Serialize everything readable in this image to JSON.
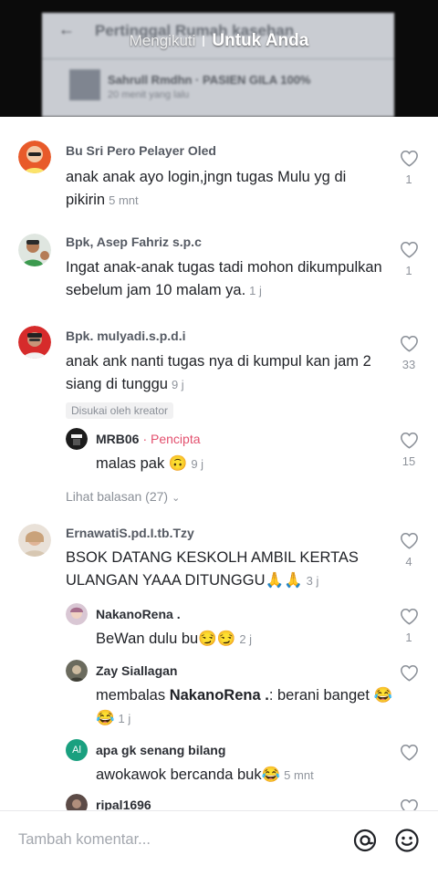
{
  "video": {
    "header_text": "Pertinggal Rumah kasehan",
    "author_name": "Sahrull Rmdhn · PASIEN GILA 100%",
    "author_sub": "20 menit yang lalu"
  },
  "feed_tabs": {
    "following": "Mengikuti",
    "for_you": "Untuk Anda"
  },
  "comments": [
    {
      "username": "Bu Sri Pero Pelayer Oled",
      "text": "anak anak ayo login,jngn tugas Mulu yg di pikirin",
      "time": "5 mnt",
      "likes": "1"
    },
    {
      "username": "Bpk, Asep Fahriz s.p.c",
      "text": "Ingat anak-anak tugas tadi mohon dikumpulkan sebelum jam 10 malam ya.",
      "time": "1 j",
      "likes": "1"
    },
    {
      "username": "Bpk. mulyadi.s.p.d.i",
      "text": "anak ank nanti tugas nya di kumpul kan jam 2 siang di tunggu",
      "time": "9 j",
      "likes": "33",
      "liked_by_creator": "Disukai oleh kreator",
      "reply": {
        "username": "MRB06",
        "creator_label": "· Pencipta",
        "text": "malas pak 🙃",
        "time": "9 j",
        "likes": "15"
      },
      "view_replies": "Lihat balasan (27)"
    },
    {
      "username": "ErnawatiS.pd.I.tb.Tzy",
      "text": "BSOK DATANG KESKOLH AMBIL KERTAS ULANGAN YAAA DITUNGGU🙏🙏",
      "time": "3 j",
      "likes": "4",
      "replies": [
        {
          "username": "NakanoRena .",
          "text": "BeWan dulu bu😏😏",
          "time": "2 j",
          "likes": "1"
        },
        {
          "username": "Zay Siallagan",
          "reply_prefix": "membalas ",
          "mention": "NakanoRena .",
          "text_after": ": berani banget 😂😂",
          "time": "1 j"
        },
        {
          "username": "apa gk senang bilang",
          "avatar_initials": "Al",
          "text": "awokawok bercanda buk😂",
          "time": "5 mnt"
        },
        {
          "username": "ripal1696"
        }
      ]
    }
  ],
  "composer": {
    "placeholder": "Tambah komentar..."
  },
  "colors": {
    "creator_accent": "#e3506e",
    "muted_text": "#8f949c",
    "sheet_bg": "#ffffff"
  }
}
